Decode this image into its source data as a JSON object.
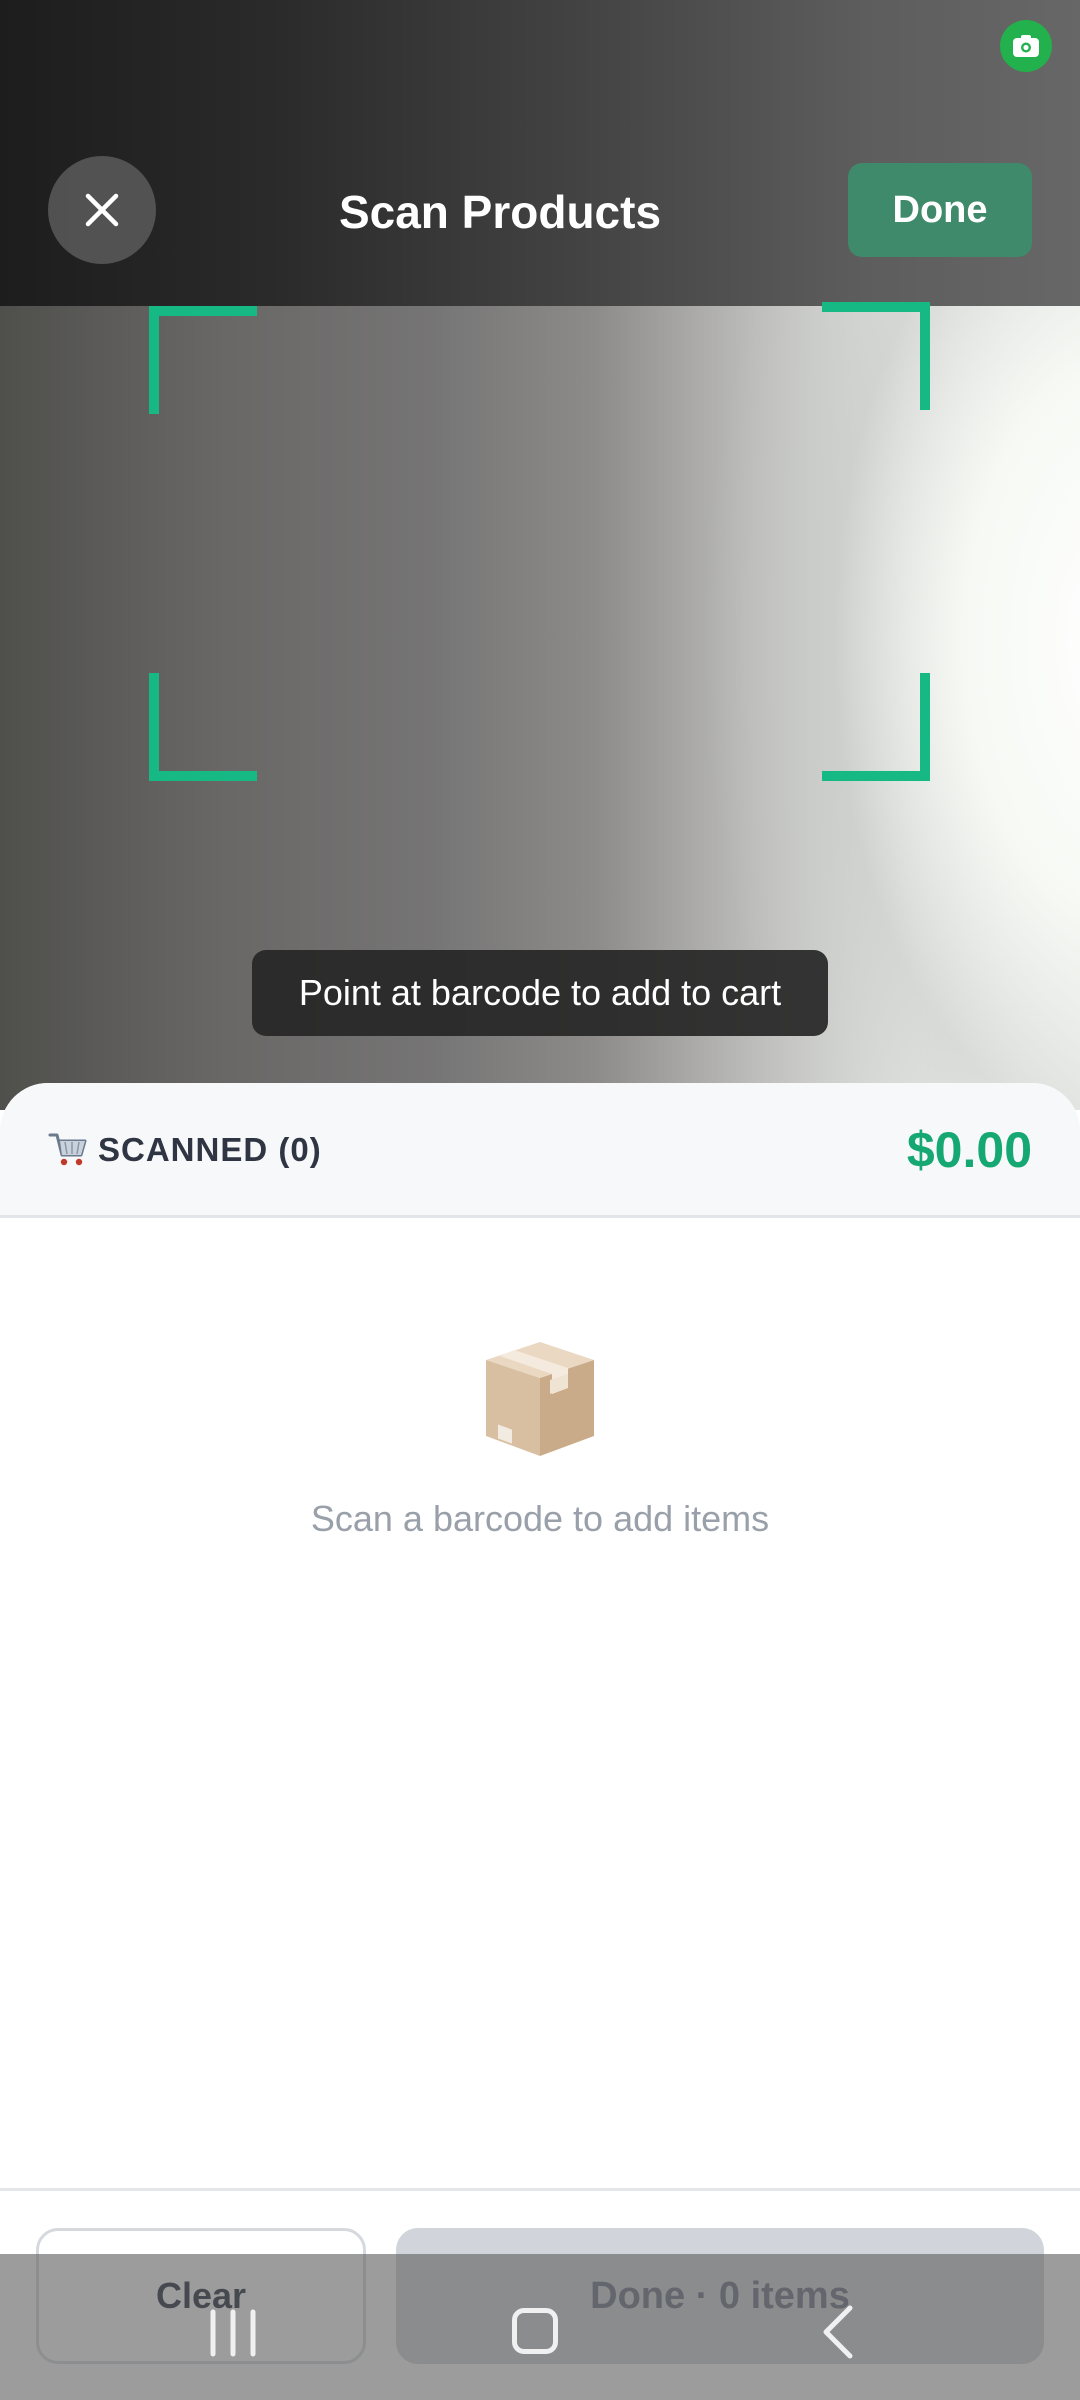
{
  "header": {
    "title": "Scan Products",
    "done_label": "Done",
    "close_icon": "close-icon"
  },
  "camera": {
    "hint": "Point at barcode to add to cart",
    "frame_color": "#16b884"
  },
  "cart": {
    "icon": "shopping-cart-icon",
    "scanned_label": "SCANNED (0)",
    "total": "$0.00",
    "empty_icon": "package-box-icon",
    "empty_message": "Scan a barcode to add items"
  },
  "footer": {
    "clear_label": "Clear",
    "done_items_label": "Done · 0 items"
  },
  "colors": {
    "accent": "#16a872",
    "done_button": "#3f8a6b",
    "disabled_button": "#d1d5db"
  }
}
